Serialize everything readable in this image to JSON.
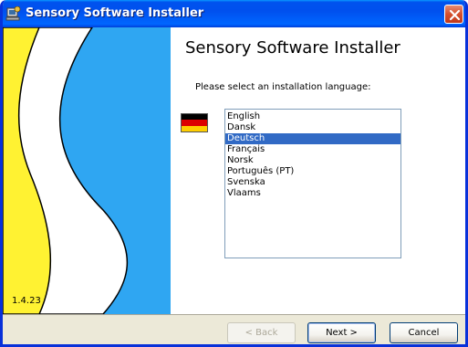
{
  "window": {
    "title": "Sensory Software Installer",
    "title_icon": "installer-icon",
    "close_icon": "close-icon"
  },
  "banner": {
    "version": "1.4.23",
    "colors": {
      "yellow": "#fff232",
      "white": "#ffffff",
      "blue": "#2fa6f2"
    }
  },
  "content": {
    "heading": "Sensory Software Installer",
    "prompt": "Please select an installation language:",
    "flag": "germany-flag",
    "languages": [
      "English",
      "Dansk",
      "Deutsch",
      "Français",
      "Norsk",
      "Português (PT)",
      "Svenska",
      "Vlaams"
    ],
    "selected_language": "Deutsch"
  },
  "buttons": {
    "back": "< Back",
    "next": "Next >",
    "cancel": "Cancel"
  }
}
